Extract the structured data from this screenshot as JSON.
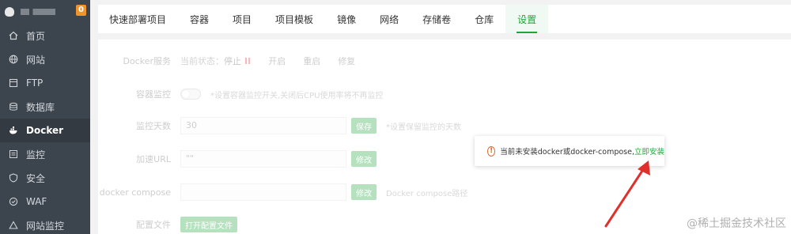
{
  "header": {
    "badge_count": "0"
  },
  "sidebar": {
    "items": [
      {
        "label": "首页",
        "icon": "home-icon"
      },
      {
        "label": "网站",
        "icon": "globe-icon"
      },
      {
        "label": "FTP",
        "icon": "ftp-icon"
      },
      {
        "label": "数据库",
        "icon": "database-icon"
      },
      {
        "label": "Docker",
        "icon": "docker-icon"
      },
      {
        "label": "监控",
        "icon": "monitor-icon"
      },
      {
        "label": "安全",
        "icon": "shield-icon"
      },
      {
        "label": "WAF",
        "icon": "waf-icon"
      },
      {
        "label": "网站监控",
        "icon": "site-monitor-icon"
      }
    ],
    "active": "Docker"
  },
  "tabs": [
    {
      "label": "快速部署项目"
    },
    {
      "label": "容器"
    },
    {
      "label": "项目"
    },
    {
      "label": "项目模板"
    },
    {
      "label": "镜像"
    },
    {
      "label": "网络"
    },
    {
      "label": "存储卷"
    },
    {
      "label": "仓库"
    },
    {
      "label": "设置"
    }
  ],
  "settings": {
    "docker_service": {
      "label": "Docker服务",
      "status_prefix": "当前状态：",
      "status_value": "停止",
      "pause_glyph": "II",
      "actions": [
        "开启",
        "重启",
        "修复"
      ]
    },
    "container_monitor": {
      "label": "容器监控",
      "hint": "*设置容器监控开关,关闭后CPU使用率将不再监控"
    },
    "monitor_days": {
      "label": "监控天数",
      "value": "30",
      "button": "保存",
      "hint": "*设置保留监控的天数"
    },
    "accel_url": {
      "label": "加速URL",
      "value": "\"\"",
      "button": "修改"
    },
    "docker_compose": {
      "label": "docker compose",
      "value": "",
      "button": "修改",
      "hint": "Docker compose路径"
    },
    "config_file": {
      "label": "配置文件",
      "button": "打开配置文件"
    }
  },
  "popup": {
    "message": "当前未安装docker或docker-compose,",
    "link": "立即安装"
  },
  "watermark": "@稀土掘金技术社区",
  "colors": {
    "accent": "#20a53a",
    "sidebar_bg": "#3c444d",
    "badge": "#f0932b",
    "arrow": "#e0302c"
  }
}
